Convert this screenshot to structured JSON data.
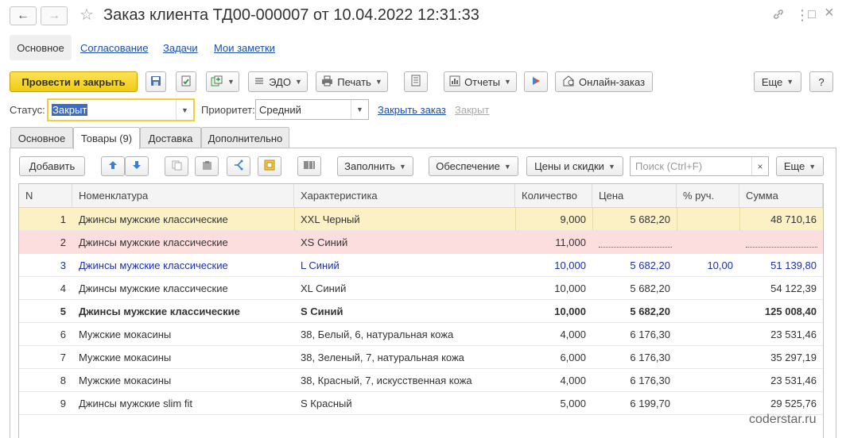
{
  "window": {
    "title": "Заказ клиента ТД00-000007 от 10.04.2022 12:31:33",
    "back_icon": "←",
    "forward_icon": "→",
    "star_icon": "☆",
    "link_icon": "🔗",
    "more_icon": "⋮",
    "maximize_icon": "□",
    "close_icon": "×"
  },
  "section_nav": {
    "items": [
      "Основное",
      "Согласование",
      "Задачи",
      "Мои заметки"
    ]
  },
  "toolbar": {
    "post_close": "Провести и закрыть",
    "edo": "ЭДО",
    "print": "Печать",
    "reports": "Отчеты",
    "online_order": "Онлайн-заказ",
    "more": "Еще",
    "help": "?"
  },
  "form": {
    "status_label": "Статус:",
    "status_value": "Закрыт",
    "priority_label": "Приоритет:",
    "priority_value": "Средний",
    "close_order_link": "Закрыть заказ",
    "closed_link": "Закрыт"
  },
  "tabs": [
    "Основное",
    "Товары (9)",
    "Доставка",
    "Дополнительно"
  ],
  "table_toolbar": {
    "add": "Добавить",
    "fill": "Заполнить",
    "supply": "Обеспечение",
    "prices": "Цены и скидки",
    "search_placeholder": "Поиск (Ctrl+F)",
    "search_clear": "×",
    "more": "Еще"
  },
  "table": {
    "columns": [
      "N",
      "Номенклатура",
      "Характеристика",
      "Количество",
      "Цена",
      "% руч.",
      "Сумма"
    ],
    "rows": [
      {
        "n": "1",
        "item": "Джинсы мужские классические",
        "char": "XXL Черный",
        "qty": "9,000",
        "price": "5 682,20",
        "pct": "",
        "sum": "48 710,16"
      },
      {
        "n": "2",
        "item": "Джинсы мужские классические",
        "char": "XS Синий",
        "qty": "11,000",
        "price": "",
        "pct": "",
        "sum": ""
      },
      {
        "n": "3",
        "item": "Джинсы мужские классические",
        "char": "L Синий",
        "qty": "10,000",
        "price": "5 682,20",
        "pct": "10,00",
        "sum": "51 139,80"
      },
      {
        "n": "4",
        "item": "Джинсы мужские классические",
        "char": "XL Синий",
        "qty": "10,000",
        "price": "5 682,20",
        "pct": "",
        "sum": "54 122,39"
      },
      {
        "n": "5",
        "item": "Джинсы мужские классические",
        "char": "S Синий",
        "qty": "10,000",
        "price": "5 682,20",
        "pct": "",
        "sum": "125 008,40"
      },
      {
        "n": "6",
        "item": "Мужские мокасины",
        "char": "38, Белый, 6, натуральная кожа",
        "qty": "4,000",
        "price": "6 176,30",
        "pct": "",
        "sum": "23 531,46"
      },
      {
        "n": "7",
        "item": "Мужские мокасины",
        "char": "38, Зеленый, 7, натуральная кожа",
        "qty": "6,000",
        "price": "6 176,30",
        "pct": "",
        "sum": "35 297,19"
      },
      {
        "n": "8",
        "item": "Мужские мокасины",
        "char": "38, Красный, 7, искусственная кожа",
        "qty": "4,000",
        "price": "6 176,30",
        "pct": "",
        "sum": "23 531,46"
      },
      {
        "n": "9",
        "item": "Джинсы мужские slim fit",
        "char": "S Красный",
        "qty": "5,000",
        "price": "6 199,70",
        "pct": "",
        "sum": "29 525,76"
      }
    ]
  },
  "watermark": "coderstar.ru",
  "colors": {
    "accent_yellow": "#f1cb10",
    "selected_row": "#fcf1c5",
    "error_row": "#fddede",
    "manual_row_text": "#1a2fb0",
    "link": "#1a4fad"
  }
}
